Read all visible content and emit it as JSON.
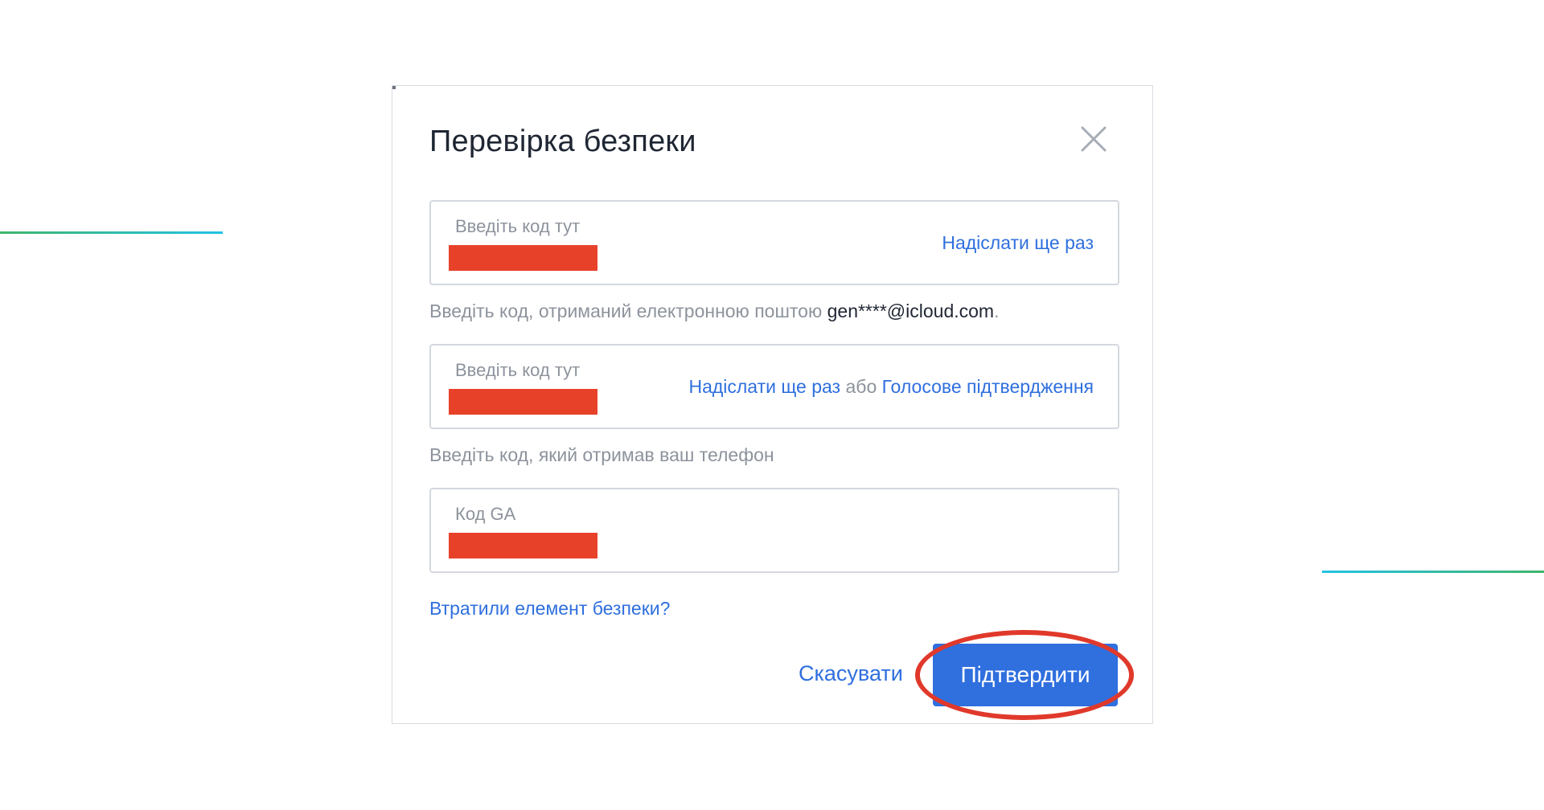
{
  "colors": {
    "accent": "#2f6fde",
    "redaction": "#e8412a",
    "highlight": "#e0392b",
    "deco_green": "#3fb56b",
    "deco_cyan": "#23c1e6"
  },
  "dialog": {
    "title": "Перевірка безпеки",
    "close_icon": "close-icon"
  },
  "email_field": {
    "label": "Введіть код тут",
    "resend": "Надіслати ще раз",
    "hint_prefix": "Введіть код, отриманий електронною поштою ",
    "hint_email": "gen****@icloud.com",
    "hint_suffix": "."
  },
  "phone_field": {
    "label": "Введіть код тут",
    "resend": "Надіслати ще раз",
    "or": " або ",
    "voice": "Голосове підтвердження",
    "hint": "Введіть код, який отримав ваш телефон"
  },
  "ga_field": {
    "label": "Код GA"
  },
  "lost_link": "Втратили елемент безпеки?",
  "buttons": {
    "cancel": "Скасувати",
    "confirm": "Підтвердити"
  }
}
